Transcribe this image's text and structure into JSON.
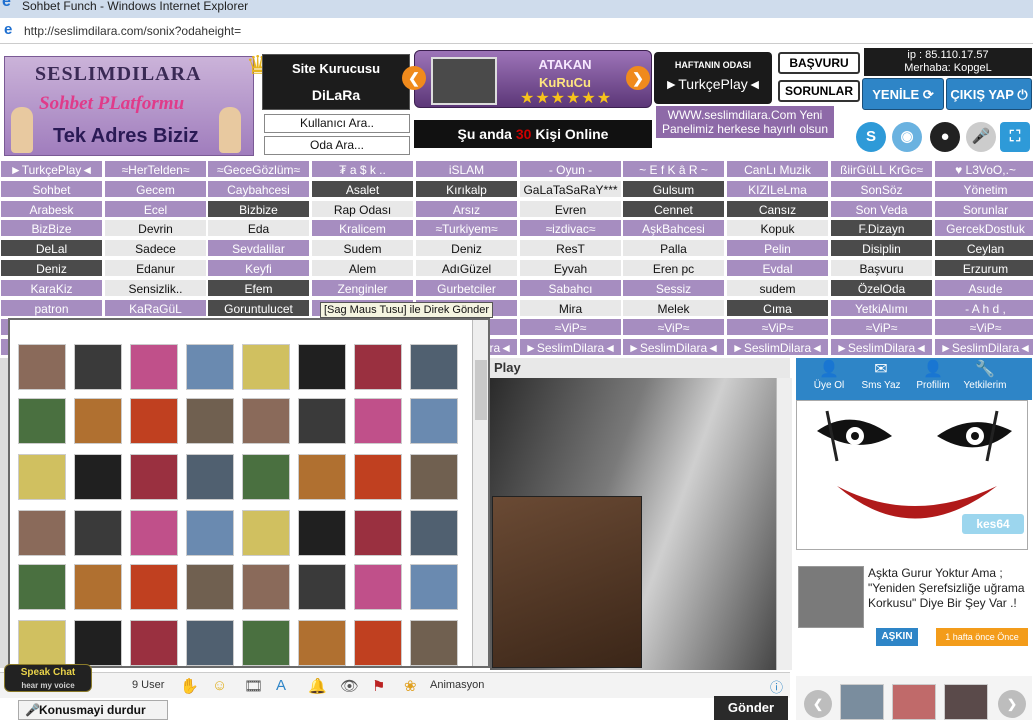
{
  "window": {
    "title": "Sohbet Funch - Windows Internet Explorer"
  },
  "address": {
    "url": "http://seslimdilara.com/sonix?odaheight="
  },
  "header": {
    "logo_top": "SESLIMDILARA",
    "logo_mid": "Sohbet PLatformu",
    "logo_bottom": "Tek Adres Biziz",
    "site_kurucu_label": "Site Kurucusu",
    "site_kurucu_name": "DiLaRa",
    "kullanici_ara": "Kullanıcı Ara..",
    "oda_ara": "Oda Ara...",
    "dj_name": "ATAKAN",
    "dj_role": "KuRuCu",
    "online_prefix": "Şu anda",
    "online_count": "30",
    "online_suffix": "Kişi Online",
    "haftanin_label": "HAFTANIN ODASI",
    "haftanin_room": "►TurkçePlay◄",
    "yeni_text": "WWW.seslimdilara.Com Yeni Panelimiz herkese hayırlı olsun",
    "basvuru": "BAŞVURU",
    "sorunlar": "SORUNLAR",
    "ip_text": "ip : 85.110.17.57",
    "merhaba_text": "Merhaba: KopgeL",
    "yenile": "YENİLE",
    "cikis": "ÇIKIŞ YAP"
  },
  "rooms": [
    [
      "►TurkçePlay◄",
      "≈HerTelden≈",
      "≈GeceGözlüm≈",
      "₮ a $ k ..",
      "iSLAM",
      "- Oyun -",
      "~ E f K â R ~",
      "CanLı Muzik",
      "ßiirGüLL KrGc≈",
      "♥ L3VoO,.~"
    ],
    [
      "Sohbet",
      "Gecem",
      "Caybahcesi",
      "Asalet",
      "Kırıkalp",
      "GaLaTaSaRaY***",
      "Gulsum",
      "KIZILeLma",
      "SonSöz",
      "Yönetim"
    ],
    [
      "Arabesk",
      "Ecel",
      "Bizbize",
      "Rap Odası",
      "Arsız",
      "Evren",
      "Cennet",
      "Cansız",
      "Son Veda",
      "Sorunlar"
    ],
    [
      "BizBize",
      "Devrin",
      "Eda",
      "Kralicem",
      "≈Turkiyem≈",
      "≈izdivac≈",
      "AşkBahcesi",
      "Kopuk",
      "F.Dizayn",
      "GercekDostluk"
    ],
    [
      "DeLal",
      "Sadece",
      "Sevdalilar",
      "Sudem",
      "Deniz",
      "ResT",
      "Palla",
      "Pelin",
      "Disiplin",
      "Ceylan"
    ],
    [
      "Deniz",
      "Edanur",
      "Keyfi",
      "Alem",
      "AdıGüzel",
      "Eyvah",
      "Eren pc",
      "Evdal",
      "Başvuru",
      "Erzurum"
    ],
    [
      "KaraKiz",
      "Sensizlik..",
      "Efem",
      "Zenginler",
      "Gurbetciler",
      "Sabahcı",
      "Sessiz",
      "sudem",
      "ÖzelOda",
      "Asude"
    ],
    [
      "patron",
      "KaRaGüL",
      "Goruntulucet",
      "",
      "",
      "Mira",
      "Melek",
      "Cıma",
      "YetkiAlımı",
      "- A h d ,"
    ],
    [
      "",
      "",
      "",
      "",
      "",
      "≈ViP≈",
      "≈ViP≈",
      "≈ViP≈",
      "≈ViP≈",
      "≈ViP≈"
    ],
    [
      "",
      "",
      "",
      "",
      "►SeslimDilara◄",
      "►SeslimDilara◄",
      "►SeslimDilara◄",
      "►SeslimDilara◄",
      "►SeslimDilara◄",
      "►SeslimDilara◄"
    ]
  ],
  "tooltip": "[Sag Maus Tusu] ile Direk Gönder",
  "chat": {
    "room_title_partial": "Play"
  },
  "side": {
    "nav": [
      "Üye Ol",
      "Sms Yaz",
      "Profilim",
      "Yetkilerim"
    ],
    "badge_user": "kes64",
    "post_text": "Aşkta Gurur Yoktur Ama ; \"Yeniden Şerefsizliğe uğrama Korkusu\" Diye Bir Şey Var .!",
    "post_tag": "AŞKIN",
    "post_time": "1 hafta önce Önce"
  },
  "bottom": {
    "users": "9 User",
    "animasyon": "Animasyon",
    "speak_brand": "Speak Chat",
    "speak_tag": "hear my voice",
    "konusma": "Konusmayi durdur",
    "gonder": "Gönder"
  },
  "colors": {
    "purple": "#a68dc0",
    "dark": "#4b4b4b",
    "accent_blue": "#2e85c7",
    "orange": "#f08a1c"
  }
}
